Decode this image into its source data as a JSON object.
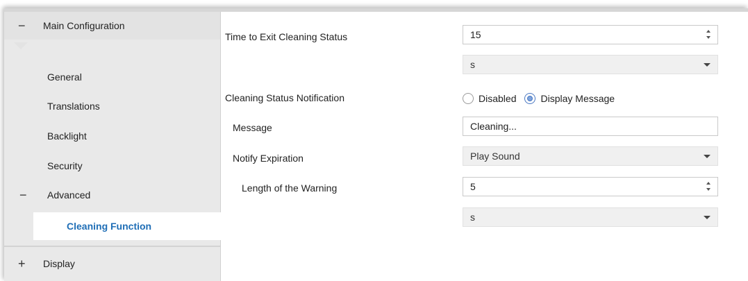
{
  "sidebar": {
    "main_configuration": {
      "sign": "−",
      "label": "Main Configuration"
    },
    "items": [
      {
        "label": "General"
      },
      {
        "label": "Translations"
      },
      {
        "label": "Backlight"
      },
      {
        "label": "Security"
      }
    ],
    "advanced": {
      "sign": "−",
      "label": "Advanced"
    },
    "cleaning_function": {
      "label": "Cleaning Function"
    },
    "display": {
      "sign": "+",
      "label": "Display"
    }
  },
  "params": {
    "time_to_exit": {
      "label": "Time to Exit Cleaning Status",
      "value": "15",
      "unit": "s"
    },
    "notification": {
      "label": "Cleaning Status Notification",
      "options": [
        "Disabled",
        "Display Message"
      ],
      "selected": "Display Message"
    },
    "message": {
      "label": "Message",
      "value": "Cleaning..."
    },
    "notify_expiration": {
      "label": "Notify Expiration",
      "value": "Play Sound"
    },
    "warning_length": {
      "label": "Length of the Warning",
      "value": "5",
      "unit": "s"
    }
  },
  "colors": {
    "active_item": "#1f6eb6",
    "sidebar_bg": "#e9e9e9",
    "radio_selected": "#7ea4dd"
  }
}
